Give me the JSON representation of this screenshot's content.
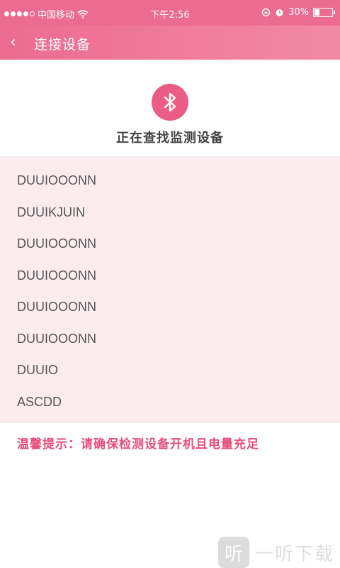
{
  "statusbar": {
    "carrier": "中国移动",
    "time": "下午2:56",
    "battery": "30%",
    "battery_level": 0.3
  },
  "header": {
    "back_icon": "‹",
    "title": "连接设备"
  },
  "search": {
    "icon": "bluetooth-icon",
    "status_text": "正在查找监测设备"
  },
  "devices": [
    {
      "name": "DUUIOOONN"
    },
    {
      "name": "DUUIKJUIN"
    },
    {
      "name": "DUUIOOONN"
    },
    {
      "name": "DUUIOOONN"
    },
    {
      "name": "DUUIOOONN"
    },
    {
      "name": "DUUIOOONN"
    },
    {
      "name": "DUUIO"
    },
    {
      "name": "ASCDD"
    }
  ],
  "tip": "温馨提示：请确保检测设备开机且电量充足",
  "watermark": {
    "logo_char": "听",
    "text": "一听下载"
  },
  "colors": {
    "accent": "#ec6b90",
    "list_bg": "#fdecef",
    "tip": "#e84f7d"
  }
}
